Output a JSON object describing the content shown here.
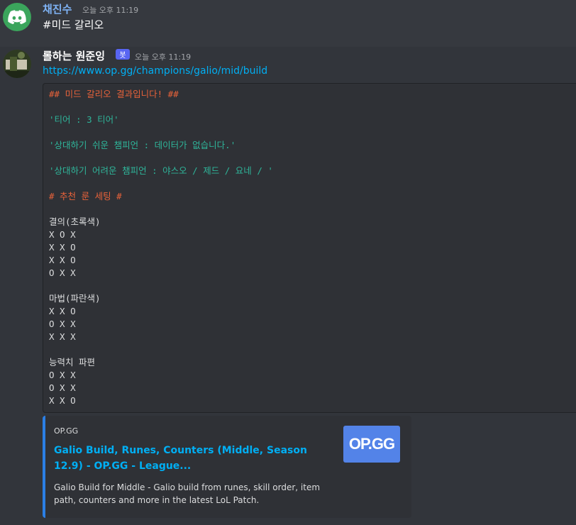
{
  "messages": [
    {
      "username": "채진수",
      "timestamp": "오늘 오후 11:19",
      "content": "#미드 갈리오"
    },
    {
      "username": "롤하는 원준잉",
      "bot_badge": "봇",
      "timestamp": "오늘 오후 11:19",
      "link": "https://www.op.gg/champions/galio/mid/build",
      "code_lines": [
        {
          "text": "## 미드 갈리오 결과입니다! ##",
          "color": "orange"
        },
        {
          "text": "",
          "color": "blank"
        },
        {
          "text": "'티어 : 3 티어'",
          "color": "teal"
        },
        {
          "text": "",
          "color": "blank"
        },
        {
          "text": "'상대하기 쉬운 챔피언 : 데이터가 없습니다.'",
          "color": "teal"
        },
        {
          "text": "",
          "color": "blank"
        },
        {
          "text": "'상대하기 어려운 챔피언 : 야스오 / 제드 / 요네 / '",
          "color": "teal"
        },
        {
          "text": "",
          "color": "blank"
        },
        {
          "text": "# 추천 룬 세팅 #",
          "color": "orange"
        },
        {
          "text": "",
          "color": "blank"
        },
        {
          "text": "결의(초록색)",
          "color": "plain"
        },
        {
          "text": "X O X",
          "color": "plain"
        },
        {
          "text": "X X O",
          "color": "plain"
        },
        {
          "text": "X X O",
          "color": "plain"
        },
        {
          "text": "O X X",
          "color": "plain"
        },
        {
          "text": "",
          "color": "blank"
        },
        {
          "text": "마법(파란색)",
          "color": "plain"
        },
        {
          "text": "X X O",
          "color": "plain"
        },
        {
          "text": "O X X",
          "color": "plain"
        },
        {
          "text": "X X X",
          "color": "plain"
        },
        {
          "text": "",
          "color": "blank"
        },
        {
          "text": "능력치 파편",
          "color": "plain"
        },
        {
          "text": "O X X",
          "color": "plain"
        },
        {
          "text": "O X X",
          "color": "plain"
        },
        {
          "text": "X X O",
          "color": "plain"
        }
      ],
      "embed": {
        "provider": "OP.GG",
        "title": "Galio Build, Runes, Counters (Middle, Season 12.9) - OP.GG - League...",
        "description": "Galio Build for Middle - Galio build from runes, skill order, item path, counters and more in the latest LoL Patch.",
        "thumbnail_text": "OP.GG"
      }
    }
  ],
  "colors": {
    "background": "#36393f",
    "link": "#00aff4",
    "code_orange": "#e8623a",
    "code_teal": "#2fb59a",
    "embed_accent": "#2b7fe5",
    "discord_green": "#3ba55c",
    "bot_badge": "#5865f2"
  }
}
